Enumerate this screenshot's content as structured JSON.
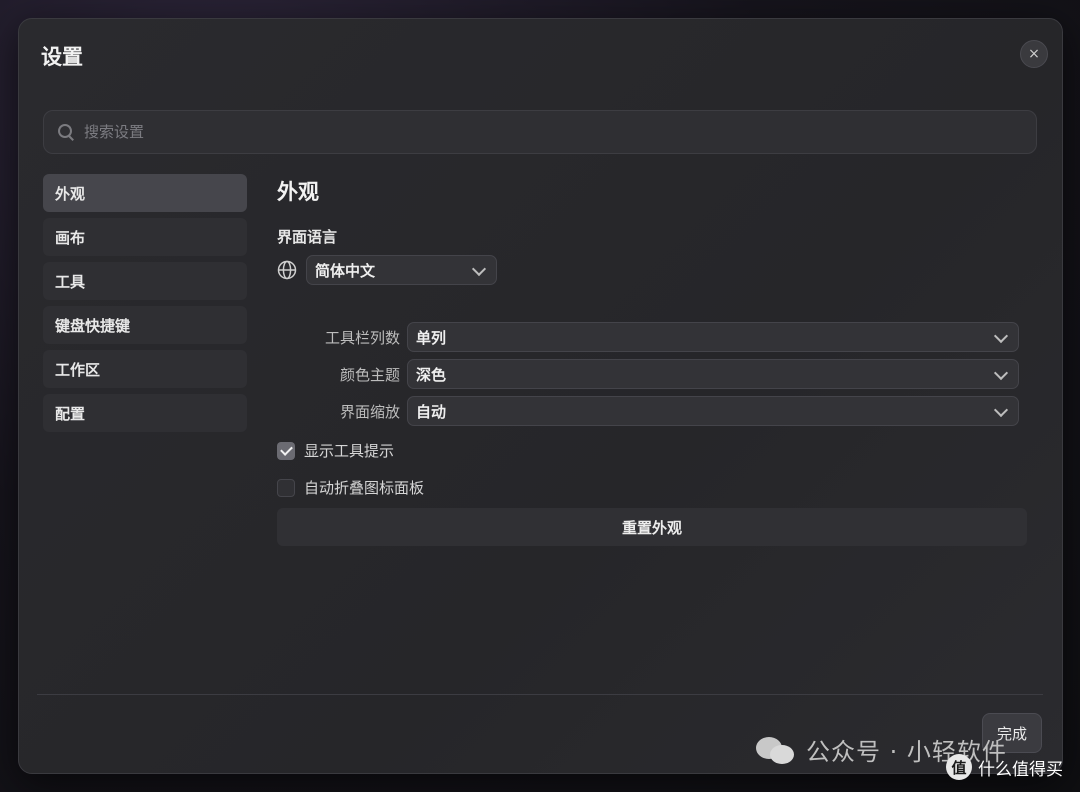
{
  "dialog": {
    "title": "设置",
    "close_label": "×"
  },
  "search": {
    "placeholder": "搜索设置",
    "value": ""
  },
  "sidebar": {
    "items": [
      {
        "label": "外观",
        "active": true
      },
      {
        "label": "画布",
        "active": false
      },
      {
        "label": "工具",
        "active": false
      },
      {
        "label": "键盘快捷键",
        "active": false
      },
      {
        "label": "工作区",
        "active": false
      },
      {
        "label": "配置",
        "active": false
      }
    ]
  },
  "appearance": {
    "title": "外观",
    "language_label": "界面语言",
    "language_value": "简体中文",
    "rows": [
      {
        "label": "工具栏列数",
        "value": "单列"
      },
      {
        "label": "颜色主题",
        "value": "深色"
      },
      {
        "label": "界面缩放",
        "value": "自动"
      }
    ],
    "checks": [
      {
        "label": "显示工具提示",
        "checked": true
      },
      {
        "label": "自动折叠图标面板",
        "checked": false
      }
    ],
    "reset_label": "重置外观"
  },
  "footer": {
    "done_label": "完成"
  },
  "watermark": {
    "text": "公众号 · 小轻软件",
    "badge_char": "值",
    "badge_text": "什么值得买"
  }
}
